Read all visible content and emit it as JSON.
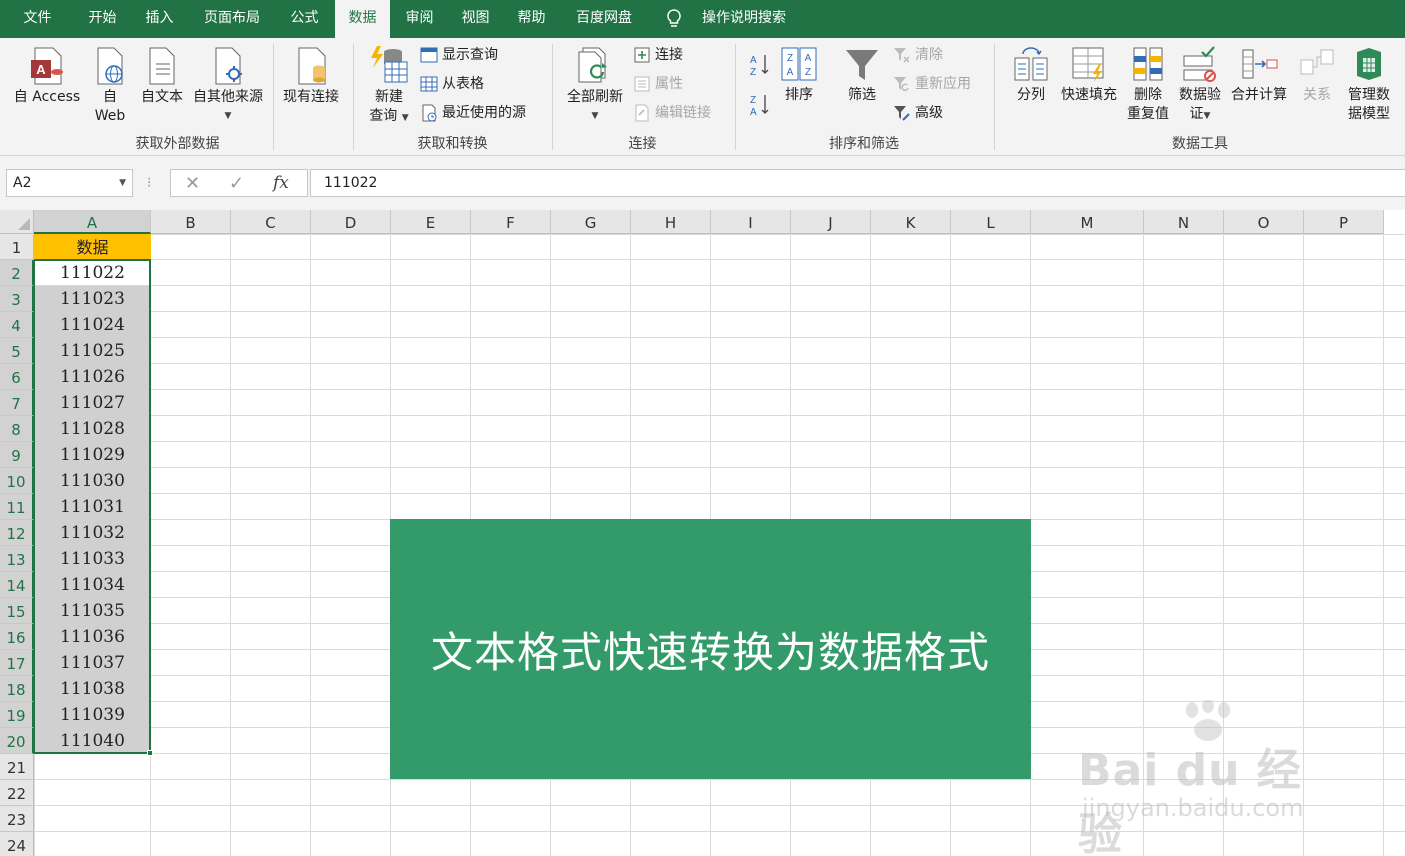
{
  "menu": {
    "tabs": [
      {
        "label": "文件"
      },
      {
        "label": "开始"
      },
      {
        "label": "插入"
      },
      {
        "label": "页面布局"
      },
      {
        "label": "公式"
      },
      {
        "label": "数据"
      },
      {
        "label": "审阅"
      },
      {
        "label": "视图"
      },
      {
        "label": "帮助"
      },
      {
        "label": "百度网盘"
      }
    ],
    "active_tab": "数据",
    "search_label": "操作说明搜索"
  },
  "ribbon": {
    "get_external": {
      "access": "自 Access",
      "web_line1": "自",
      "web_line2": "Web",
      "text": "自文本",
      "other": "自其他来源",
      "existing": "现有连接",
      "label": "获取外部数据"
    },
    "get_transform": {
      "new_query_line1": "新建",
      "new_query_line2": "查询",
      "show_query": "显示查询",
      "from_table": "从表格",
      "recent_sources": "最近使用的源",
      "label": "获取和转换"
    },
    "connections": {
      "refresh_all": "全部刷新",
      "connections": "连接",
      "properties": "属性",
      "edit_links": "编辑链接",
      "label": "连接"
    },
    "sort_filter": {
      "sort": "排序",
      "filter": "筛选",
      "clear": "清除",
      "reapply": "重新应用",
      "advanced": "高级",
      "label": "排序和筛选"
    },
    "data_tools": {
      "split": "分列",
      "flash_fill": "快速填充",
      "remove_dup_line1": "删除",
      "remove_dup_line2": "重复值",
      "validation_line1": "数据验",
      "validation_line2": "证",
      "consolidate": "合并计算",
      "relationships": "关系",
      "manage_line1": "管理数",
      "manage_line2": "据模型",
      "label": "数据工具"
    }
  },
  "formula_bar": {
    "name_box": "A2",
    "fx": "fx",
    "value": "111022"
  },
  "sheet": {
    "columns": [
      "A",
      "B",
      "C",
      "D",
      "E",
      "F",
      "G",
      "H",
      "I",
      "J",
      "K",
      "L",
      "M",
      "N",
      "O",
      "P"
    ],
    "rows": [
      "1",
      "2",
      "3",
      "4",
      "5",
      "6",
      "7",
      "8",
      "9",
      "10",
      "11",
      "12",
      "13",
      "14",
      "15",
      "16",
      "17",
      "18",
      "19",
      "20",
      "21",
      "22",
      "23",
      "24"
    ],
    "header_cell": "数据",
    "values": [
      "111022",
      "111023",
      "111024",
      "111025",
      "111026",
      "111027",
      "111028",
      "111029",
      "111030",
      "111031",
      "111032",
      "111033",
      "111034",
      "111035",
      "111036",
      "111037",
      "111038",
      "111039",
      "111040"
    ],
    "header_color": "#ffc000",
    "selection_color": "#217346"
  },
  "banner": {
    "text": "文本格式快速转换为数据格式",
    "color": "#339b69"
  },
  "watermark": {
    "brand": "Bai du 经验",
    "url": "jingyan.baidu.com"
  }
}
